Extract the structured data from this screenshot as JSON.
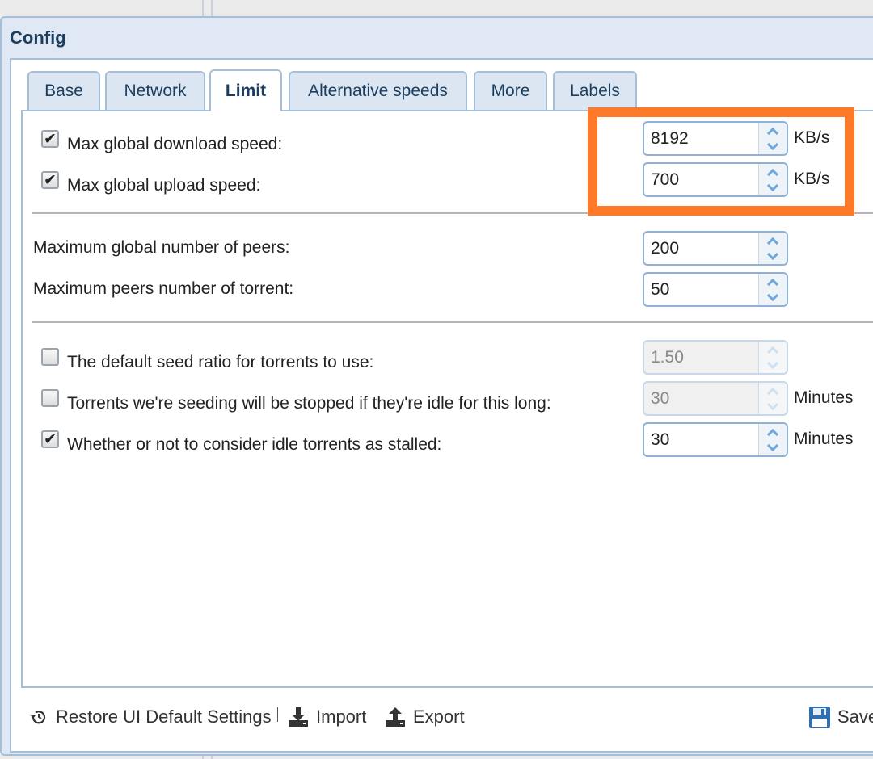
{
  "dialog": {
    "title": "Config",
    "tabs": [
      {
        "label": "Base"
      },
      {
        "label": "Network"
      },
      {
        "label": "Limit"
      },
      {
        "label": "Alternative speeds"
      },
      {
        "label": "More"
      },
      {
        "label": "Labels"
      }
    ],
    "active_tab": "Limit"
  },
  "limits": {
    "download": {
      "label": "Max global download speed:",
      "checked": true,
      "value": "8192",
      "unit": "KB/s"
    },
    "upload": {
      "label": "Max global upload speed:",
      "checked": true,
      "value": "700",
      "unit": "KB/s"
    },
    "peers_global": {
      "label": "Maximum global number of peers:",
      "value": "200"
    },
    "peers_torrent": {
      "label": "Maximum peers number of torrent:",
      "value": "50"
    },
    "seed_ratio": {
      "label": "The default seed ratio for torrents to use:",
      "checked": false,
      "value": "1.50",
      "disabled": true
    },
    "idle_stop": {
      "label": "Torrents we're seeding will be stopped if they're idle for this long:",
      "checked": false,
      "value": "30",
      "unit": "Minutes",
      "disabled": true
    },
    "idle_stalled": {
      "label": "Whether or not to consider idle torrents as stalled:",
      "checked": true,
      "value": "30",
      "unit": "Minutes"
    }
  },
  "footer": {
    "restore_label": "Restore UI Default Settings",
    "import_label": "Import",
    "export_label": "Export",
    "save_label": "Save"
  },
  "colors": {
    "highlight": "#ff7a28",
    "border": "#a6bfd9",
    "title": "#1c3e5e"
  }
}
